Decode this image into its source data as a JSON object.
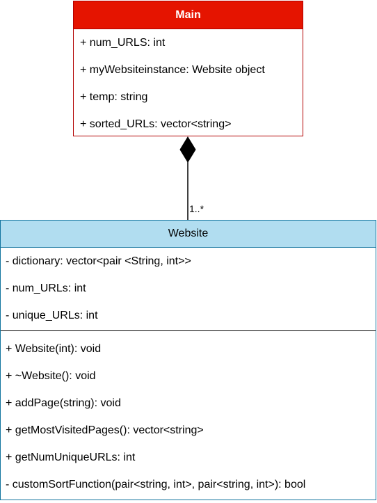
{
  "main_class": {
    "name": "Main",
    "attributes": [
      "+ num_URLS: int",
      "+ myWebsiteinstance: Website object",
      "+ temp: string",
      "+ sorted_URLs: vector<string>"
    ]
  },
  "website_class": {
    "name": "Website",
    "attributes": [
      "- dictionary: vector<pair <String, int>>",
      "- num_URLs: int",
      "- unique_URLs: int"
    ],
    "methods": [
      "+ Website(int): void",
      "+ ~Website(): void",
      "+ addPage(string): void",
      "+ getMostVisitedPages(): vector<string>",
      "+ getNumUniqueURLs: int",
      "- customSortFunction(pair<string, int>, pair<string, int>): bool"
    ]
  },
  "association": {
    "type": "composition",
    "multiplicity": "1..*"
  },
  "colors": {
    "main_header_fill": "#e51400",
    "main_border": "#b20000",
    "website_header_fill": "#b1ddf0",
    "website_border": "#10739e"
  }
}
